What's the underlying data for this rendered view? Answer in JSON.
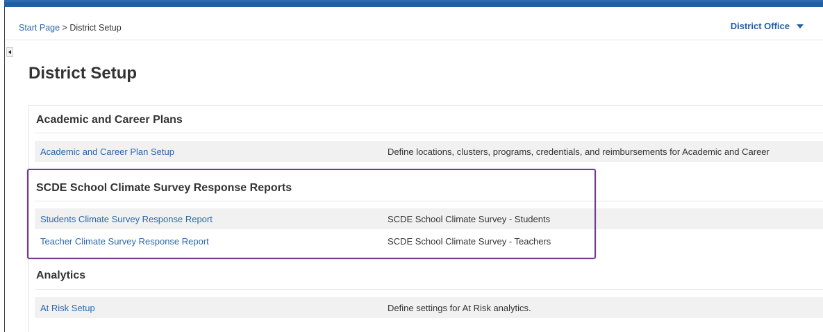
{
  "breadcrumb": {
    "start": "Start Page",
    "separator": " > ",
    "current": "District Setup"
  },
  "context_menu": {
    "label": "District Office",
    "icon": "caret-down-icon"
  },
  "page": {
    "title": "District Setup"
  },
  "sections": [
    {
      "heading": "Academic and Career Plans",
      "rows": [
        {
          "link": "Academic and Career Plan Setup",
          "description": "Define locations, clusters, programs, credentials, and reimbursements for Academic and Career"
        }
      ]
    },
    {
      "heading": "SCDE School Climate Survey Response Reports",
      "rows": [
        {
          "link": "Students Climate Survey Response Report",
          "description": "SCDE School Climate Survey - Students"
        },
        {
          "link": "Teacher Climate Survey Response Report",
          "description": "SCDE School Climate Survey - Teachers"
        }
      ]
    },
    {
      "heading": "Analytics",
      "rows": [
        {
          "link": "At Risk Setup",
          "description": "Define settings for At Risk analytics."
        }
      ]
    }
  ],
  "colors": {
    "accent": "#1f5fa6",
    "link": "#2a67ac",
    "highlight": "#6c3b8f"
  }
}
